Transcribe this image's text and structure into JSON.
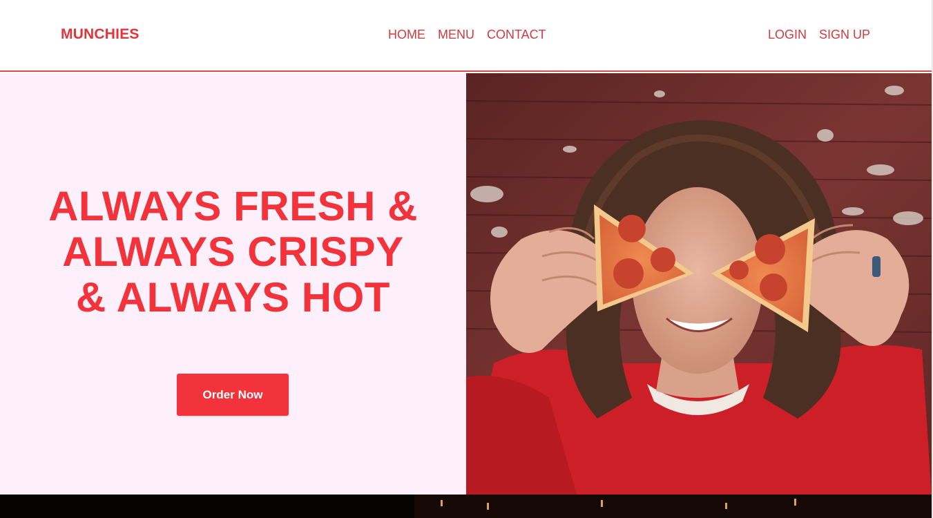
{
  "navbar": {
    "brand": "MUNCHIES",
    "center_links": [
      "HOME",
      "MENU",
      "CONTACT"
    ],
    "right_links": [
      "LOGIN",
      "SIGN UP"
    ]
  },
  "hero": {
    "title_lines": [
      "ALWAYS FRESH &",
      "ALWAYS CRISPY",
      "& ALWAYS HOT"
    ],
    "cta_label": "Order Now",
    "image_subject": "smiling-person-holding-pizza-slices-over-eyes"
  },
  "colors": {
    "accent": "#f2333b",
    "nav_text": "#d23a3e",
    "hero_left_bg": "#fdf0fb",
    "bottom_band": "#050302"
  }
}
